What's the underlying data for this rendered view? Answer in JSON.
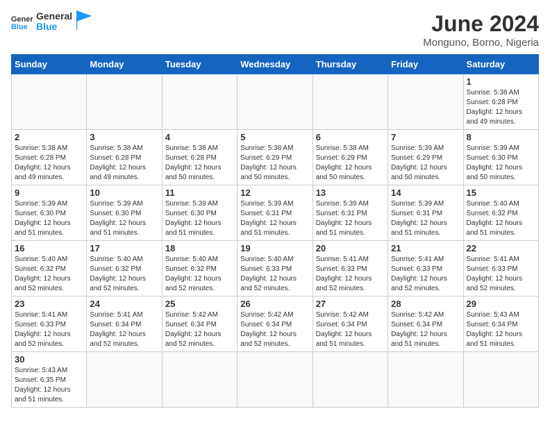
{
  "header": {
    "logo_general": "General",
    "logo_blue": "Blue",
    "title": "June 2024",
    "location": "Monguno, Borno, Nigeria"
  },
  "weekdays": [
    "Sunday",
    "Monday",
    "Tuesday",
    "Wednesday",
    "Thursday",
    "Friday",
    "Saturday"
  ],
  "weeks": [
    [
      {
        "day": "",
        "info": ""
      },
      {
        "day": "",
        "info": ""
      },
      {
        "day": "",
        "info": ""
      },
      {
        "day": "",
        "info": ""
      },
      {
        "day": "",
        "info": ""
      },
      {
        "day": "",
        "info": ""
      },
      {
        "day": "1",
        "info": "Sunrise: 5:38 AM\nSunset: 6:28 PM\nDaylight: 12 hours\nand 49 minutes."
      }
    ],
    [
      {
        "day": "2",
        "info": "Sunrise: 5:38 AM\nSunset: 6:28 PM\nDaylight: 12 hours\nand 49 minutes."
      },
      {
        "day": "3",
        "info": "Sunrise: 5:38 AM\nSunset: 6:28 PM\nDaylight: 12 hours\nand 49 minutes."
      },
      {
        "day": "4",
        "info": "Sunrise: 5:38 AM\nSunset: 6:28 PM\nDaylight: 12 hours\nand 50 minutes."
      },
      {
        "day": "5",
        "info": "Sunrise: 5:38 AM\nSunset: 6:29 PM\nDaylight: 12 hours\nand 50 minutes."
      },
      {
        "day": "6",
        "info": "Sunrise: 5:38 AM\nSunset: 6:29 PM\nDaylight: 12 hours\nand 50 minutes."
      },
      {
        "day": "7",
        "info": "Sunrise: 5:39 AM\nSunset: 6:29 PM\nDaylight: 12 hours\nand 50 minutes."
      },
      {
        "day": "8",
        "info": "Sunrise: 5:39 AM\nSunset: 6:30 PM\nDaylight: 12 hours\nand 50 minutes."
      }
    ],
    [
      {
        "day": "9",
        "info": "Sunrise: 5:39 AM\nSunset: 6:30 PM\nDaylight: 12 hours\nand 51 minutes."
      },
      {
        "day": "10",
        "info": "Sunrise: 5:39 AM\nSunset: 6:30 PM\nDaylight: 12 hours\nand 51 minutes."
      },
      {
        "day": "11",
        "info": "Sunrise: 5:39 AM\nSunset: 6:30 PM\nDaylight: 12 hours\nand 51 minutes."
      },
      {
        "day": "12",
        "info": "Sunrise: 5:39 AM\nSunset: 6:31 PM\nDaylight: 12 hours\nand 51 minutes."
      },
      {
        "day": "13",
        "info": "Sunrise: 5:39 AM\nSunset: 6:31 PM\nDaylight: 12 hours\nand 51 minutes."
      },
      {
        "day": "14",
        "info": "Sunrise: 5:39 AM\nSunset: 6:31 PM\nDaylight: 12 hours\nand 51 minutes."
      },
      {
        "day": "15",
        "info": "Sunrise: 5:40 AM\nSunset: 6:32 PM\nDaylight: 12 hours\nand 51 minutes."
      }
    ],
    [
      {
        "day": "16",
        "info": "Sunrise: 5:40 AM\nSunset: 6:32 PM\nDaylight: 12 hours\nand 52 minutes."
      },
      {
        "day": "17",
        "info": "Sunrise: 5:40 AM\nSunset: 6:32 PM\nDaylight: 12 hours\nand 52 minutes."
      },
      {
        "day": "18",
        "info": "Sunrise: 5:40 AM\nSunset: 6:32 PM\nDaylight: 12 hours\nand 52 minutes."
      },
      {
        "day": "19",
        "info": "Sunrise: 5:40 AM\nSunset: 6:33 PM\nDaylight: 12 hours\nand 52 minutes."
      },
      {
        "day": "20",
        "info": "Sunrise: 5:41 AM\nSunset: 6:33 PM\nDaylight: 12 hours\nand 52 minutes."
      },
      {
        "day": "21",
        "info": "Sunrise: 5:41 AM\nSunset: 6:33 PM\nDaylight: 12 hours\nand 52 minutes."
      },
      {
        "day": "22",
        "info": "Sunrise: 5:41 AM\nSunset: 6:33 PM\nDaylight: 12 hours\nand 52 minutes."
      }
    ],
    [
      {
        "day": "23",
        "info": "Sunrise: 5:41 AM\nSunset: 6:33 PM\nDaylight: 12 hours\nand 52 minutes."
      },
      {
        "day": "24",
        "info": "Sunrise: 5:41 AM\nSunset: 6:34 PM\nDaylight: 12 hours\nand 52 minutes."
      },
      {
        "day": "25",
        "info": "Sunrise: 5:42 AM\nSunset: 6:34 PM\nDaylight: 12 hours\nand 52 minutes."
      },
      {
        "day": "26",
        "info": "Sunrise: 5:42 AM\nSunset: 6:34 PM\nDaylight: 12 hours\nand 52 minutes."
      },
      {
        "day": "27",
        "info": "Sunrise: 5:42 AM\nSunset: 6:34 PM\nDaylight: 12 hours\nand 51 minutes."
      },
      {
        "day": "28",
        "info": "Sunrise: 5:42 AM\nSunset: 6:34 PM\nDaylight: 12 hours\nand 51 minutes."
      },
      {
        "day": "29",
        "info": "Sunrise: 5:43 AM\nSunset: 6:34 PM\nDaylight: 12 hours\nand 51 minutes."
      }
    ],
    [
      {
        "day": "30",
        "info": "Sunrise: 5:43 AM\nSunset: 6:35 PM\nDaylight: 12 hours\nand 51 minutes."
      },
      {
        "day": "",
        "info": ""
      },
      {
        "day": "",
        "info": ""
      },
      {
        "day": "",
        "info": ""
      },
      {
        "day": "",
        "info": ""
      },
      {
        "day": "",
        "info": ""
      },
      {
        "day": "",
        "info": ""
      }
    ]
  ]
}
